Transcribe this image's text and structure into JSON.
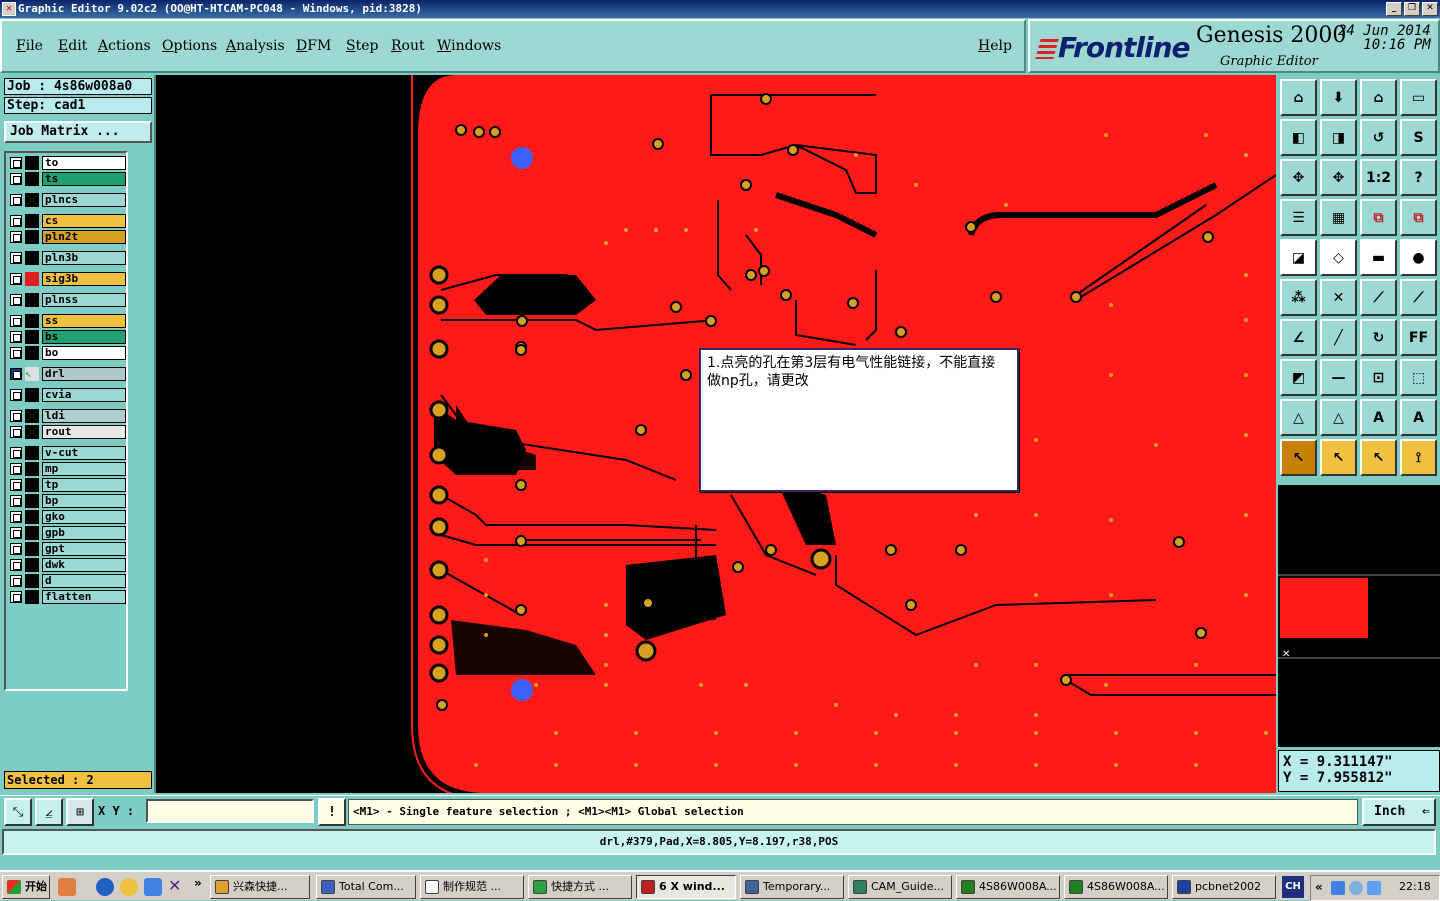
{
  "window": {
    "title": "Graphic Editor 9.02c2 (OO@HT-HTCAM-PC048 - Windows, pid:3828)",
    "app_icon": "x-icon",
    "controls": [
      "_",
      "❐",
      "✕"
    ]
  },
  "menu": {
    "items": [
      "File",
      "Edit",
      "Actions",
      "Options",
      "Analysis",
      "DFM",
      "Step",
      "Rout",
      "Windows"
    ],
    "help": "Help"
  },
  "brand": {
    "logo": "Frontline",
    "product": "Genesis 2000",
    "subtitle": "Graphic Editor",
    "date": "24 Jun 2014",
    "time": "10:16 PM"
  },
  "job": {
    "job_line": "Job : 4s86w008a0",
    "step_line": "Step: cad1",
    "matrix_button": "Job Matrix ..."
  },
  "layers": [
    {
      "name": "to",
      "bg": "#ffffff",
      "swatch": "#000000",
      "mark": "✎"
    },
    {
      "name": "ts",
      "bg": "#20a070",
      "swatch": "#000000",
      "mark": ""
    },
    {
      "name": "plncs",
      "bg": "#9ed8d2",
      "swatch": "#000000",
      "mark": ""
    },
    {
      "name": "cs",
      "bg": "#f0c040",
      "swatch": "#000000",
      "mark": ""
    },
    {
      "name": "pln2t",
      "bg": "#d8a020",
      "swatch": "#000000",
      "mark": ""
    },
    {
      "name": "pln3b",
      "bg": "#9ed8d2",
      "swatch": "#000000",
      "mark": ""
    },
    {
      "name": "sig3b",
      "bg": "#f0c040",
      "swatch": "#e02020",
      "mark": "✎"
    },
    {
      "name": "plnss",
      "bg": "#9ed8d2",
      "swatch": "#000000",
      "mark": ""
    },
    {
      "name": "ss",
      "bg": "#f0c040",
      "swatch": "#000000",
      "mark": "✎"
    },
    {
      "name": "bs",
      "bg": "#20a070",
      "swatch": "#000000",
      "mark": ""
    },
    {
      "name": "bo",
      "bg": "#ffffff",
      "swatch": "#000000",
      "mark": ""
    },
    {
      "name": "drl",
      "bg": "#b0c8c8",
      "swatch": "#20a040",
      "mark": "⊞"
    },
    {
      "name": "cvia",
      "bg": "#9ed8d2",
      "swatch": "#000000",
      "mark": ""
    },
    {
      "name": "ldi",
      "bg": "#b0d0d0",
      "swatch": "#000000",
      "mark": ""
    },
    {
      "name": "rout",
      "bg": "#e8e8e8",
      "swatch": "#000000",
      "mark": ""
    },
    {
      "name": "v-cut",
      "bg": "#9ed8d2",
      "swatch": "#000000",
      "mark": ""
    },
    {
      "name": "mp",
      "bg": "#9ed8d2",
      "swatch": "#000000",
      "mark": ""
    },
    {
      "name": "tp",
      "bg": "#9ed8d2",
      "swatch": "#000000",
      "mark": ""
    },
    {
      "name": "bp",
      "bg": "#9ed8d2",
      "swatch": "#000000",
      "mark": ""
    },
    {
      "name": "gko",
      "bg": "#9ed8d2",
      "swatch": "#000000",
      "mark": ""
    },
    {
      "name": "gpb",
      "bg": "#9ed8d2",
      "swatch": "#000000",
      "mark": ""
    },
    {
      "name": "gpt",
      "bg": "#9ed8d2",
      "swatch": "#000000",
      "mark": ""
    },
    {
      "name": "dwk",
      "bg": "#9ed8d2",
      "swatch": "#000000",
      "mark": ""
    },
    {
      "name": "d",
      "bg": "#9ed8d2",
      "swatch": "#000000",
      "mark": ""
    },
    {
      "name": "flatten",
      "bg": "#9ed8d2",
      "swatch": "#000000",
      "mark": ""
    }
  ],
  "selected_text": "Selected : 2",
  "popup": {
    "text": "1.点亮的孔在第3层有电气性能链接，不能直接做np孔，请更改"
  },
  "coords": {
    "x_line": "X = 9.311147\"",
    "y_line": "Y = 7.955812\""
  },
  "command": {
    "xy_label": "X Y :",
    "xy_value": "",
    "prompt": "<M1> - Single feature selection ; <M1><M1> Global selection",
    "unit": "Inch"
  },
  "status": "drl,#379,Pad,X=8.805,Y=8.197,r38,POS",
  "taskbar": {
    "start": "开始",
    "tasks": [
      {
        "label": "兴森快捷...",
        "color": "#e0a030"
      },
      {
        "label": "Total Com...",
        "color": "#4060c0"
      },
      {
        "label": "制作规范 ...",
        "color": "#ffffff"
      },
      {
        "label": "快捷方式 ...",
        "color": "#30a040"
      },
      {
        "label": "6 X wind...",
        "color": "#c02020"
      },
      {
        "label": "Temporary...",
        "color": "#4060a0"
      },
      {
        "label": "CAM_Guide...",
        "color": "#308060"
      },
      {
        "label": "4S86W008A...",
        "color": "#208020"
      },
      {
        "label": "4S86W008A...",
        "color": "#208020"
      },
      {
        "label": "pcbnet2002",
        "color": "#2040a0"
      }
    ],
    "lang": "CH",
    "clock": "22:18"
  },
  "colors": {
    "board": "#ff1a1a",
    "pad": "#d8a020",
    "highlight_pad": "#4060ff",
    "background": "#000000"
  }
}
